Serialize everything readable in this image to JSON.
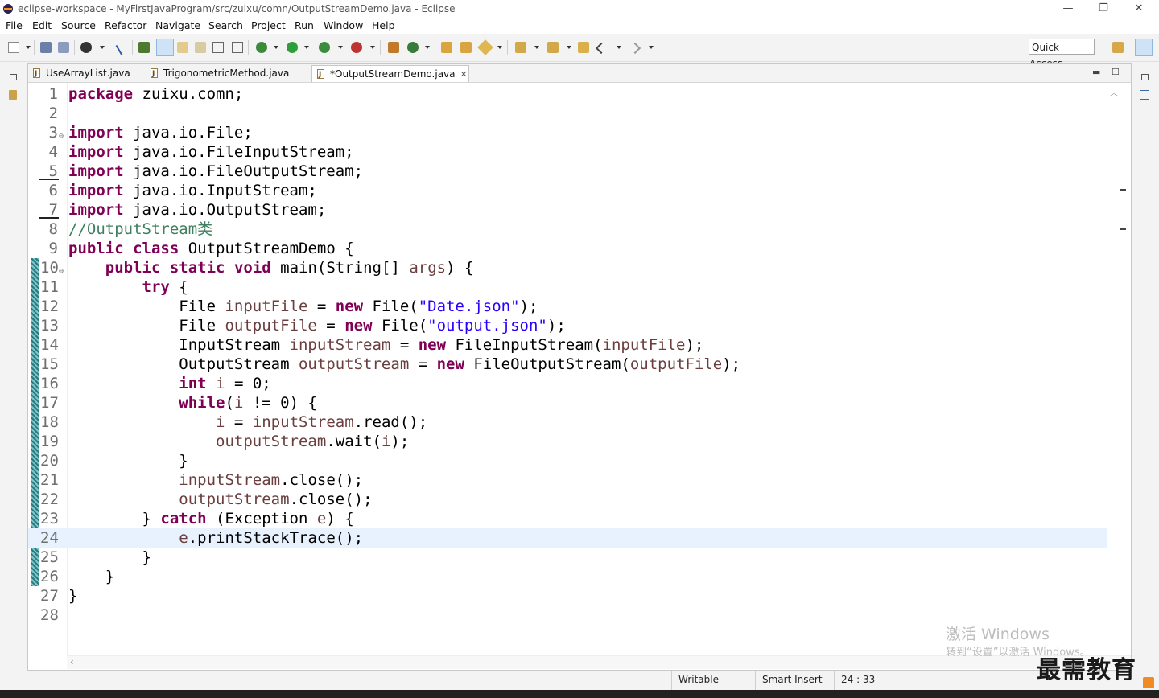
{
  "window": {
    "title": "eclipse-workspace - MyFirstJavaProgram/src/zuixu/comn/OutputStreamDemo.java - Eclipse",
    "minimize": "—",
    "restore": "❐",
    "close": "✕"
  },
  "menu": [
    "File",
    "Edit",
    "Source",
    "Refactor",
    "Navigate",
    "Search",
    "Project",
    "Run",
    "Window",
    "Help"
  ],
  "quick_access": "Quick Access",
  "tabs": [
    {
      "label": "UseArrayList.java",
      "active": false
    },
    {
      "label": "TrigonometricMethod.java",
      "active": false
    },
    {
      "label": "*OutputStreamDemo.java",
      "active": true
    }
  ],
  "code_lines": [
    {
      "n": "1",
      "html": "<span class=\"k\">package</span> zuixu.comn;"
    },
    {
      "n": "2",
      "html": ""
    },
    {
      "n": "3",
      "html": "<span class=\"k\">import</span> java.io.File;",
      "fold": true
    },
    {
      "n": "4",
      "html": "<span class=\"k\">import</span> java.io.FileInputStream;"
    },
    {
      "n": "5",
      "html": "<span class=\"k\">import</span> java.io.FileOutputStream;",
      "mark": true
    },
    {
      "n": "6",
      "html": "<span class=\"k\">import</span> java.io.InputStream;"
    },
    {
      "n": "7",
      "html": "<span class=\"k\">import</span> java.io.OutputStream;",
      "mark": true
    },
    {
      "n": "8",
      "html": "<span class=\"c\">//OutputStream类</span>"
    },
    {
      "n": "9",
      "html": "<span class=\"k\">public</span> <span class=\"k\">class</span> OutputStreamDemo {"
    },
    {
      "n": "10",
      "html": "    <span class=\"k\">public</span> <span class=\"k\">static</span> <span class=\"k\">void</span> main(String[] <span class=\"v\">args</span>) {",
      "fold": true
    },
    {
      "n": "11",
      "html": "        <span class=\"k\">try</span> {"
    },
    {
      "n": "12",
      "html": "            File <span class=\"v\">inputFile</span> = <span class=\"k\">new</span> File(<span class=\"s\">\"Date.json\"</span>);"
    },
    {
      "n": "13",
      "html": "            File <span class=\"v\">outputFile</span> = <span class=\"k\">new</span> File(<span class=\"s\">\"output.json\"</span>);"
    },
    {
      "n": "14",
      "html": "            InputStream <span class=\"v\">inputStream</span> = <span class=\"k\">new</span> FileInputStream(<span class=\"v\">inputFile</span>);"
    },
    {
      "n": "15",
      "html": "            OutputStream <span class=\"v\">outputStream</span> = <span class=\"k\">new</span> FileOutputStream(<span class=\"v\">outputFile</span>);"
    },
    {
      "n": "16",
      "html": "            <span class=\"k\">int</span> <span class=\"v\">i</span> = 0;"
    },
    {
      "n": "17",
      "html": "            <span class=\"k\">while</span>(<span class=\"v\">i</span> != 0) {"
    },
    {
      "n": "18",
      "html": "                <span class=\"v\">i</span> = <span class=\"v\">inputStream</span>.read();"
    },
    {
      "n": "19",
      "html": "                <span class=\"v\">outputStream</span>.wait(<span class=\"v\">i</span>);"
    },
    {
      "n": "20",
      "html": "            }"
    },
    {
      "n": "21",
      "html": "            <span class=\"v\">inputStream</span>.close();"
    },
    {
      "n": "22",
      "html": "            <span class=\"v\">outputStream</span>.close();"
    },
    {
      "n": "23",
      "html": "        } <span class=\"k\">catch</span> (Exception <span class=\"v\">e</span>) {"
    },
    {
      "n": "24",
      "html": "            <span class=\"v\">e</span>.printStackTrace();",
      "current": true
    },
    {
      "n": "25",
      "html": "        }"
    },
    {
      "n": "26",
      "html": "    }"
    },
    {
      "n": "27",
      "html": "}"
    },
    {
      "n": "28",
      "html": ""
    }
  ],
  "status": {
    "writable": "Writable",
    "insert_mode": "Smart Insert",
    "position": "24 : 33"
  },
  "watermark": {
    "line1": "激活 Windows",
    "line2": "转到“设置”以激活 Windows。"
  },
  "brand": "最需教育",
  "colors": {
    "keyword": "#7f0055",
    "string": "#2a00ff",
    "comment": "#3f7f5f",
    "local_var": "#6a3e3e",
    "current_line": "#e8f2fe"
  }
}
